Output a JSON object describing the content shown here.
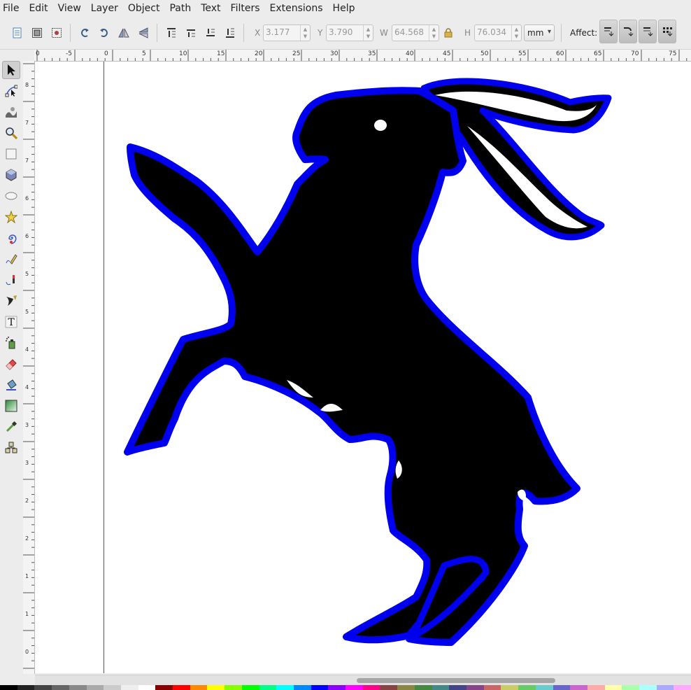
{
  "menubar": {
    "items": [
      "File",
      "Edit",
      "View",
      "Layer",
      "Object",
      "Path",
      "Text",
      "Filters",
      "Extensions",
      "Help"
    ]
  },
  "toolbar": {
    "x_label": "X",
    "x_value": "3.177",
    "y_label": "Y",
    "y_value": "3.790",
    "w_label": "W",
    "w_value": "64.568",
    "h_label": "H",
    "h_value": "76.034",
    "unit": "mm",
    "affect_label": "Affect:",
    "lock_icon": "lock-icon"
  },
  "tools": [
    {
      "name": "selector-tool",
      "active": true
    },
    {
      "name": "node-tool"
    },
    {
      "name": "tweak-tool"
    },
    {
      "name": "zoom-tool"
    },
    {
      "name": "rectangle-tool"
    },
    {
      "name": "3d-box-tool"
    },
    {
      "name": "ellipse-tool"
    },
    {
      "name": "star-tool"
    },
    {
      "name": "spiral-tool"
    },
    {
      "name": "pencil-tool"
    },
    {
      "name": "pen-tool"
    },
    {
      "name": "calligraphy-tool"
    },
    {
      "name": "text-tool"
    },
    {
      "name": "spray-tool"
    },
    {
      "name": "eraser-tool"
    },
    {
      "name": "paint-bucket-tool"
    },
    {
      "name": "gradient-tool"
    },
    {
      "name": "dropper-tool"
    },
    {
      "name": "connector-tool"
    }
  ],
  "ruler": {
    "h_labels": [
      "0",
      "-5",
      "0",
      "5",
      "10",
      "15",
      "20",
      "25",
      "30",
      "35",
      "40",
      "45",
      "50",
      "55",
      "60",
      "65",
      "70",
      "75"
    ],
    "v_labels": [
      "8",
      "7",
      "7",
      "6",
      "6",
      "5",
      "5",
      "4",
      "4",
      "3",
      "3",
      "2",
      "2",
      "1",
      "1",
      "0"
    ]
  },
  "canvas": {
    "object_fill": "#000000",
    "outline_color": "#0000ee"
  }
}
